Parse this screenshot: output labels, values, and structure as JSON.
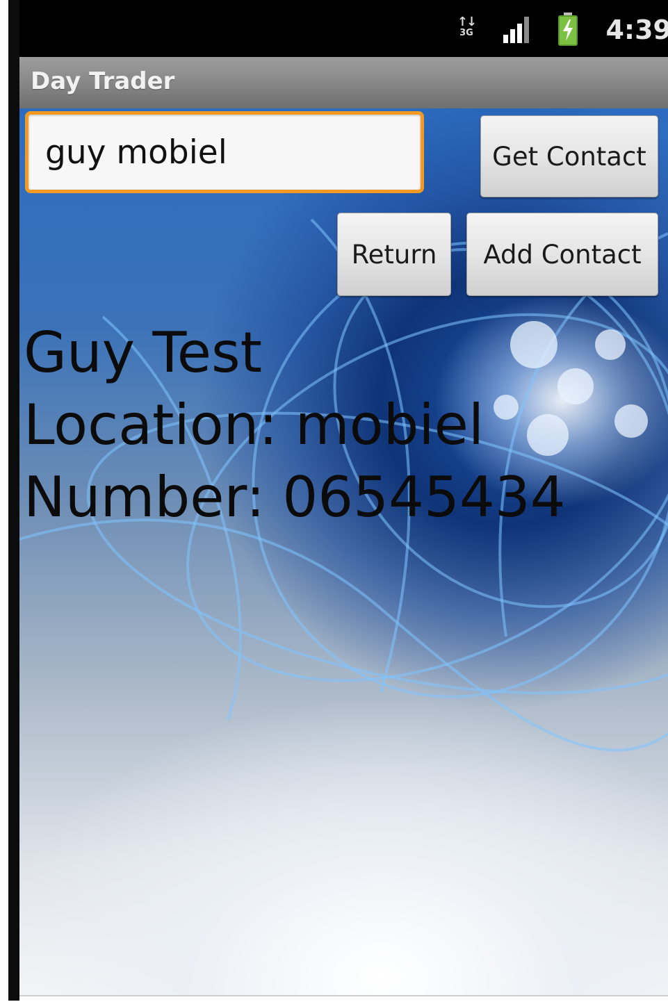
{
  "status_bar": {
    "network_type": "3G",
    "time": "4:39",
    "icons": [
      "data-transfer-icon",
      "signal-bars-icon",
      "battery-charging-icon"
    ]
  },
  "app_bar": {
    "title": "Day Trader"
  },
  "search": {
    "value": "guy mobiel",
    "focused": true,
    "accent_color": "#f39a23"
  },
  "buttons": {
    "get_contact": "Get Contact",
    "return": "Return",
    "add_contact": "Add Contact"
  },
  "contact_result": {
    "name": "Guy Test",
    "location_line": "Location: mobiel",
    "number_line": "Number: 06545434"
  },
  "colors": {
    "status_bar_bg": "#000000",
    "title_bar_bg": "#8a8a8a",
    "battery_green": "#7cc142"
  }
}
